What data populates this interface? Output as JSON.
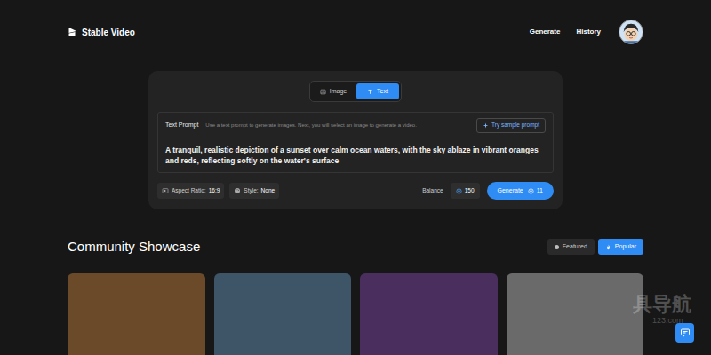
{
  "header": {
    "logo": "Stable Video",
    "nav": [
      {
        "label": "Generate"
      },
      {
        "label": "History"
      }
    ]
  },
  "mode_tabs": [
    {
      "label": "Image",
      "selected": false
    },
    {
      "label": "Text",
      "selected": true
    }
  ],
  "prompt": {
    "label": "Text Prompt",
    "hint": "Use a text prompt to generate images. Next, you will select an image to generate a video.",
    "sample_button": "Try sample prompt",
    "text": "A tranquil, realistic depiction of a sunset over calm ocean waters, with the sky ablaze in vibrant oranges and reds, reflecting softly on the water's surface"
  },
  "options": [
    {
      "label": "Aspect Ratio:",
      "value": "16:9"
    },
    {
      "label": "Style:",
      "value": "None"
    }
  ],
  "balance": {
    "label": "Balance",
    "value": "150"
  },
  "generate_button": {
    "label": "Generate",
    "cost": "11"
  },
  "showcase": {
    "title": "Community Showcase",
    "tabs": [
      {
        "label": "Featured",
        "selected": false
      },
      {
        "label": "Popular",
        "selected": true
      }
    ],
    "cards": [
      {
        "color": "#6b4a2a"
      },
      {
        "color": "#3d5566"
      },
      {
        "color": "#4a2f5e"
      },
      {
        "color": "#6a6a6a"
      }
    ]
  },
  "watermark": {
    "lines": [
      "具导航",
      "123.com"
    ]
  }
}
